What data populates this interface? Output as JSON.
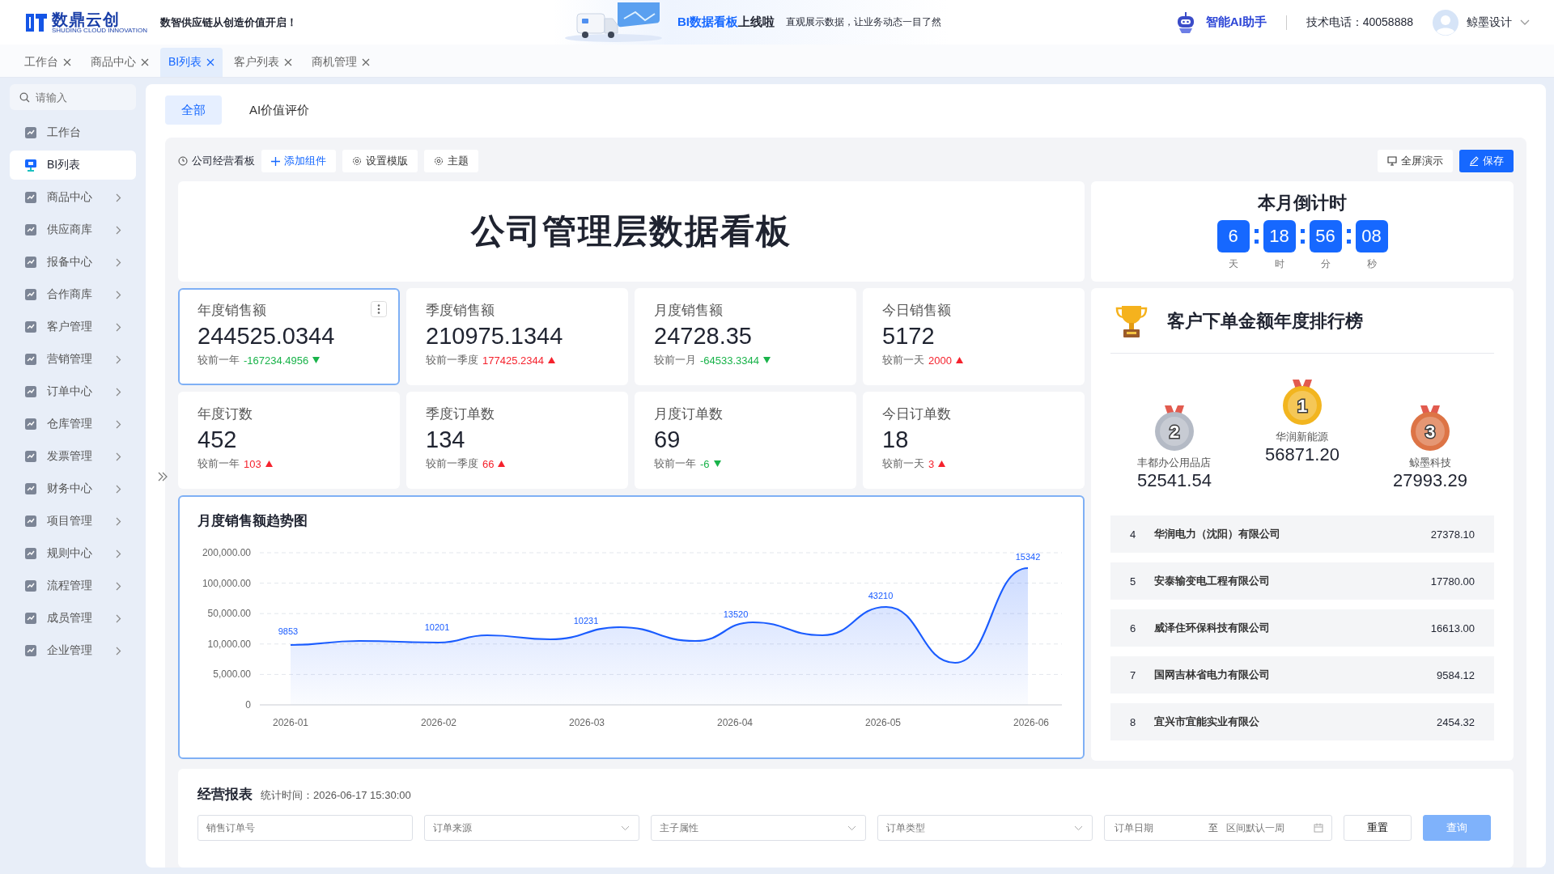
{
  "header": {
    "brand": "数鼎云创",
    "brand_sub": "SHUDING CLOUD INNOVATION",
    "tagline": "数智供应链从创造价值开启！",
    "banner": {
      "highlight": "BI数据看板",
      "title_rest": "上线啦",
      "subtitle": "直观展示数据，让业务动态一目了然"
    },
    "assistant": "智能AI助手",
    "phone": "技术电话：40058888",
    "user": "鲸墨设计"
  },
  "page_tabs": [
    {
      "label": "工作台",
      "selected": false
    },
    {
      "label": "商品中心",
      "selected": false
    },
    {
      "label": "BI列表",
      "selected": true
    },
    {
      "label": "客户列表",
      "selected": false
    },
    {
      "label": "商机管理",
      "selected": false
    }
  ],
  "sidebar": {
    "search_placeholder": "请输入",
    "items": [
      {
        "label": "工作台",
        "selected": false,
        "has_children": false
      },
      {
        "label": "BI列表",
        "selected": true,
        "has_children": false
      },
      {
        "label": "商品中心",
        "selected": false,
        "has_children": true
      },
      {
        "label": "供应商库",
        "selected": false,
        "has_children": true
      },
      {
        "label": "报备中心",
        "selected": false,
        "has_children": true
      },
      {
        "label": "合作商库",
        "selected": false,
        "has_children": true
      },
      {
        "label": "客户管理",
        "selected": false,
        "has_children": true
      },
      {
        "label": "营销管理",
        "selected": false,
        "has_children": true
      },
      {
        "label": "订单中心",
        "selected": false,
        "has_children": true
      },
      {
        "label": "仓库管理",
        "selected": false,
        "has_children": true
      },
      {
        "label": "发票管理",
        "selected": false,
        "has_children": true
      },
      {
        "label": "财务中心",
        "selected": false,
        "has_children": true
      },
      {
        "label": "项目管理",
        "selected": false,
        "has_children": true
      },
      {
        "label": "规则中心",
        "selected": false,
        "has_children": true
      },
      {
        "label": "流程管理",
        "selected": false,
        "has_children": true
      },
      {
        "label": "成员管理",
        "selected": false,
        "has_children": true
      },
      {
        "label": "企业管理",
        "selected": false,
        "has_children": true
      }
    ]
  },
  "view_tabs": [
    {
      "label": "全部",
      "selected": true
    },
    {
      "label": "AI价值评价",
      "selected": false
    }
  ],
  "toolbar": {
    "items": [
      {
        "kind": "title",
        "label": "公司经营看板"
      },
      {
        "kind": "link",
        "label": "添加组件"
      },
      {
        "kind": "button",
        "label": "设置模版"
      },
      {
        "kind": "button",
        "label": "主题"
      }
    ],
    "actions": [
      {
        "label": "全屏演示",
        "primary": false
      },
      {
        "label": "保存",
        "primary": true
      }
    ]
  },
  "dashboard_title": "公司管理层数据看板",
  "countdown": {
    "title": "本月倒计时",
    "units": [
      {
        "value": "6",
        "unit": "天"
      },
      {
        "value": "18",
        "unit": "时"
      },
      {
        "value": "56",
        "unit": "分"
      },
      {
        "value": "08",
        "unit": "秒"
      }
    ]
  },
  "stats": [
    {
      "label": "年度销售额",
      "value": "244525.0344",
      "compare": "较前一年",
      "delta": "-167234.4956",
      "rising": false,
      "selected": true
    },
    {
      "label": "季度销售额",
      "value": "210975.1344",
      "compare": "较前一季度",
      "delta": "177425.2344",
      "rising": true,
      "selected": false
    },
    {
      "label": "月度销售额",
      "value": "24728.35",
      "compare": "较前一月",
      "delta": "-64533.3344",
      "rising": false,
      "selected": false
    },
    {
      "label": "今日销售额",
      "value": "5172",
      "compare": "较前一天",
      "delta": "2000",
      "rising": true,
      "selected": false
    },
    {
      "label": "年度订数",
      "value": "452",
      "compare": "较前一年",
      "delta": "103",
      "rising": true,
      "selected": false
    },
    {
      "label": "季度订单数",
      "value": "134",
      "compare": "较前一季度",
      "delta": "66",
      "rising": true,
      "selected": false
    },
    {
      "label": "月度订单数",
      "value": "69",
      "compare": "较前一年",
      "delta": "-6",
      "rising": false,
      "selected": false
    },
    {
      "label": "今日订单数",
      "value": "18",
      "compare": "较前一天",
      "delta": "3",
      "rising": true,
      "selected": false
    }
  ],
  "trend_chart": {
    "title": "月度销售额趋势图",
    "y_labels": [
      "200,000.00",
      "100,000.00",
      "50,000.00",
      "10,000.00",
      "5,000.00",
      "0"
    ],
    "x_labels": [
      "2026-01",
      "2026-02",
      "2026-03",
      "2026-04",
      "2026-05",
      "2026-06"
    ],
    "point_labels": [
      "9853",
      "10201",
      "10231",
      "13520",
      "43210",
      "15342"
    ]
  },
  "ranking": {
    "title": "客户下单金额年度排行榜",
    "podium": [
      {
        "rank": "2",
        "color": "#b4bac5",
        "name": "丰都办公用品店",
        "amount": "52541.54"
      },
      {
        "rank": "1",
        "color": "#f2b51f",
        "name": "华润新能源",
        "amount": "56871.20"
      },
      {
        "rank": "3",
        "color": "#dd7446",
        "name": "鲸墨科技",
        "amount": "27993.29"
      }
    ],
    "rows": [
      {
        "rank": "4",
        "name": "华润电力（沈阳）有限公司",
        "amount": "27378.10"
      },
      {
        "rank": "5",
        "name": "安泰输变电工程有限公司",
        "amount": "17780.00"
      },
      {
        "rank": "6",
        "name": "威泽住环保科技有限公司",
        "amount": "16613.00"
      },
      {
        "rank": "7",
        "name": "国网吉林省电力有限公司",
        "amount": "9584.12"
      },
      {
        "rank": "8",
        "name": "宜兴市宜能实业有限公",
        "amount": "2454.32"
      }
    ]
  },
  "report": {
    "title": "经营报表",
    "stat_time": "统计时间：2026-06-17 15:30:00",
    "filters": [
      {
        "kind": "input",
        "placeholder": "销售订单号"
      },
      {
        "kind": "select",
        "placeholder": "订单来源"
      },
      {
        "kind": "select",
        "placeholder": "主子属性"
      },
      {
        "kind": "select",
        "placeholder": "订单类型"
      },
      {
        "kind": "daterange",
        "placeholder": "订单日期",
        "separator": "至",
        "end_placeholder": "区间默认一周"
      }
    ],
    "buttons": [
      {
        "label": "重置",
        "primary": false
      },
      {
        "label": "查询",
        "primary": true
      }
    ]
  }
}
